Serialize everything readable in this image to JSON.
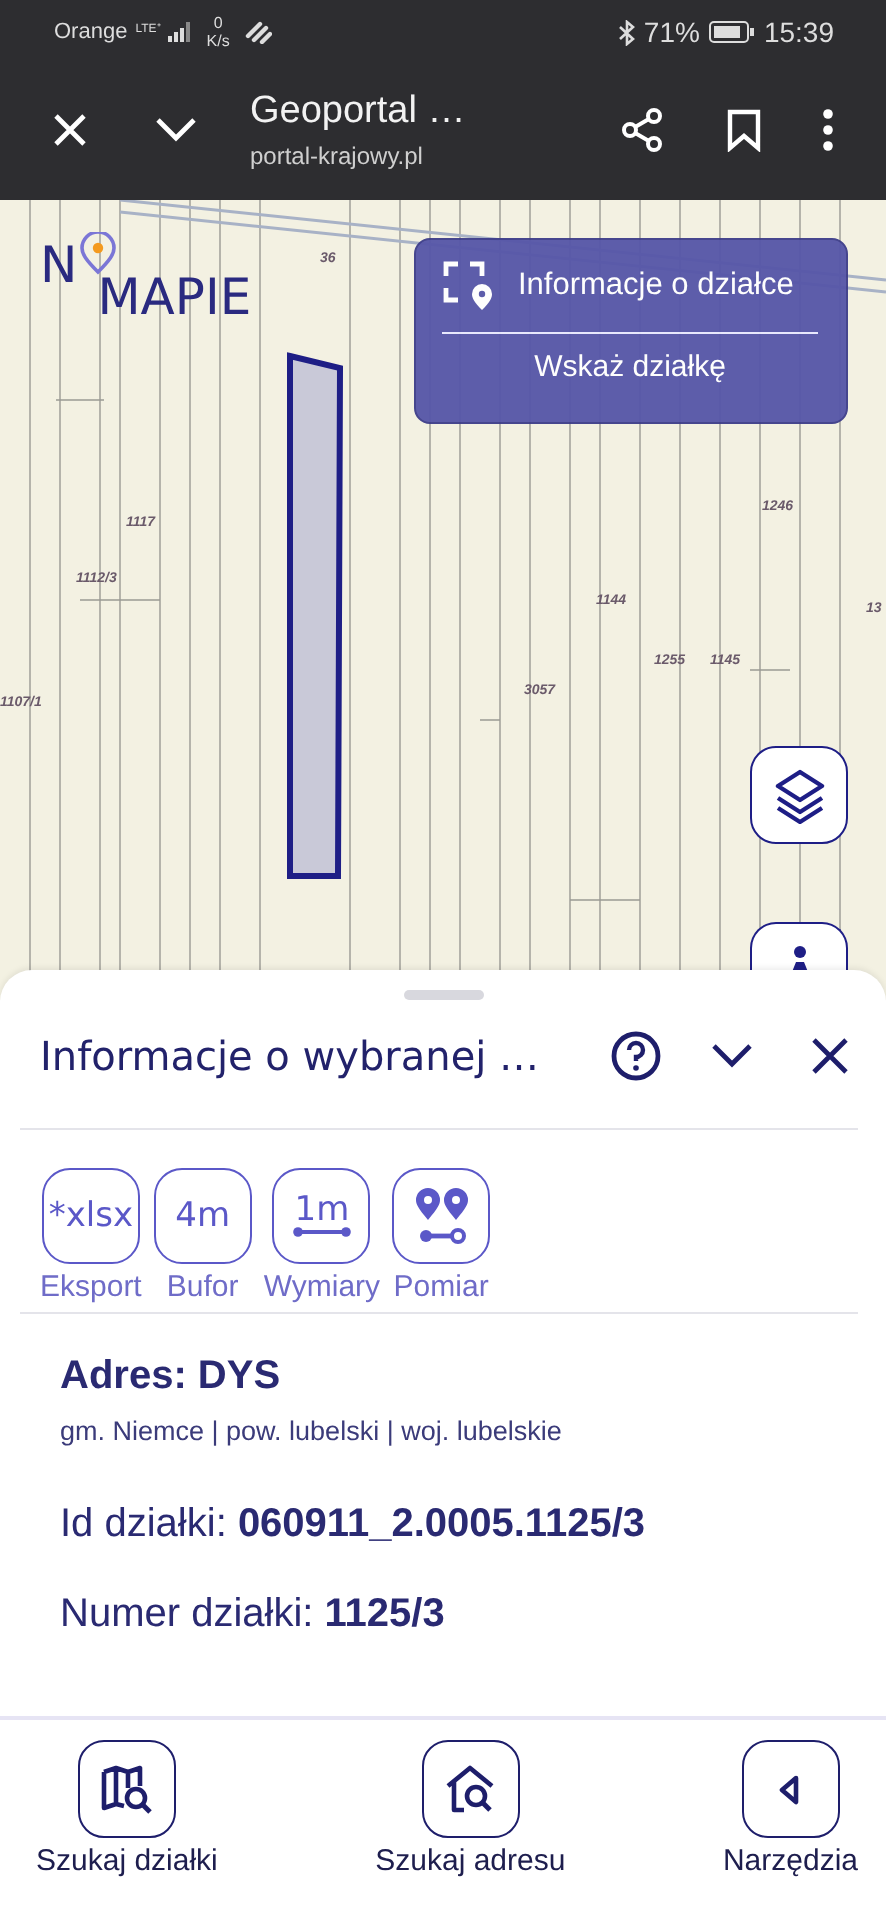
{
  "status_bar": {
    "carrier": "Orange",
    "network": "LTE⁺",
    "speed_value": "0",
    "speed_unit": "K/s",
    "battery": "71%",
    "time": "15:39"
  },
  "browser": {
    "title": "Geoportal …",
    "url": "portal-krajowy.pl"
  },
  "map": {
    "logo_left": "N",
    "logo_right": "MAPIE",
    "parcel_labels": [
      "36",
      "1246",
      "1117",
      "1112/3",
      "1144",
      "13",
      "1255",
      "1145",
      "3057",
      "1107/1"
    ],
    "info_panel": {
      "title": "Informacje o działce",
      "action": "Wskaż działkę"
    }
  },
  "sheet": {
    "title": "Informacje o wybranej …",
    "tools": [
      {
        "kind": "text",
        "icon_text": "*xlsx",
        "label": "Eksport"
      },
      {
        "kind": "text",
        "icon_text": "4m",
        "label": "Bufor"
      },
      {
        "kind": "ruler",
        "icon_text": "1m",
        "label": "Wymiary"
      },
      {
        "kind": "pins",
        "label": "Pomiar"
      }
    ],
    "address": {
      "title": "Adres: DYS",
      "subtitle": "gm. Niemce | pow. lubelski | woj. lubelskie"
    },
    "fields": [
      {
        "label": "Id działki:",
        "value": "060911_2.0005.1125/3"
      },
      {
        "label": "Numer działki:",
        "value": "1125/3"
      }
    ]
  },
  "bottom_nav": [
    {
      "kind": "map-search",
      "label": "Szukaj działki"
    },
    {
      "kind": "home-search",
      "label": "Szukaj adresu"
    },
    {
      "kind": "back",
      "label": "Narzędzia"
    }
  ]
}
